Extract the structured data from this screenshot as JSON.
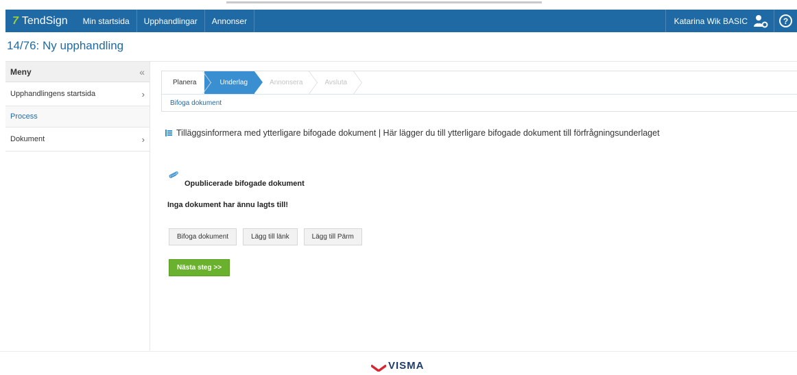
{
  "nav": {
    "logo": "TendSign",
    "items": [
      "Min startsida",
      "Upphandlingar",
      "Annonser"
    ],
    "user": "Katarina Wik BASIC",
    "user_icon": "user-settings-icon",
    "help_icon": "help-icon",
    "help_symbol": "?"
  },
  "page": {
    "title": "14/76: Ny upphandling"
  },
  "sidebar": {
    "header": "Meny",
    "collapse_symbol": "«",
    "items": [
      {
        "label": "Upphandlingens startsida",
        "chevron": "›"
      },
      {
        "label": "Process",
        "chevron": ""
      },
      {
        "label": "Dokument",
        "chevron": "›"
      }
    ]
  },
  "steps": {
    "items": [
      "Planera",
      "Underlag",
      "Annonsera",
      "Avsluta"
    ],
    "current": "Underlag",
    "sub_link": "Bifoga dokument"
  },
  "info": {
    "text": "Tilläggsinformera med ytterligare bifogade dokument  |  Här lägger du till ytterligare bifogade dokument till förfrågningsunderlaget"
  },
  "attachments": {
    "title": "Opublicerade bifogade dokument",
    "empty_message": "Inga dokument har ännu lagts till!",
    "buttons": [
      "Bifoga dokument",
      "Lägg till länk",
      "Lägg till Pärm"
    ],
    "next_button": "Nästa steg >>"
  },
  "footer": {
    "brand": "VISMA"
  },
  "colors": {
    "nav": "#1f6aa5",
    "step_active": "#3a8fd0",
    "next": "#6ab22d",
    "logo_accent": "#9bd03b"
  }
}
